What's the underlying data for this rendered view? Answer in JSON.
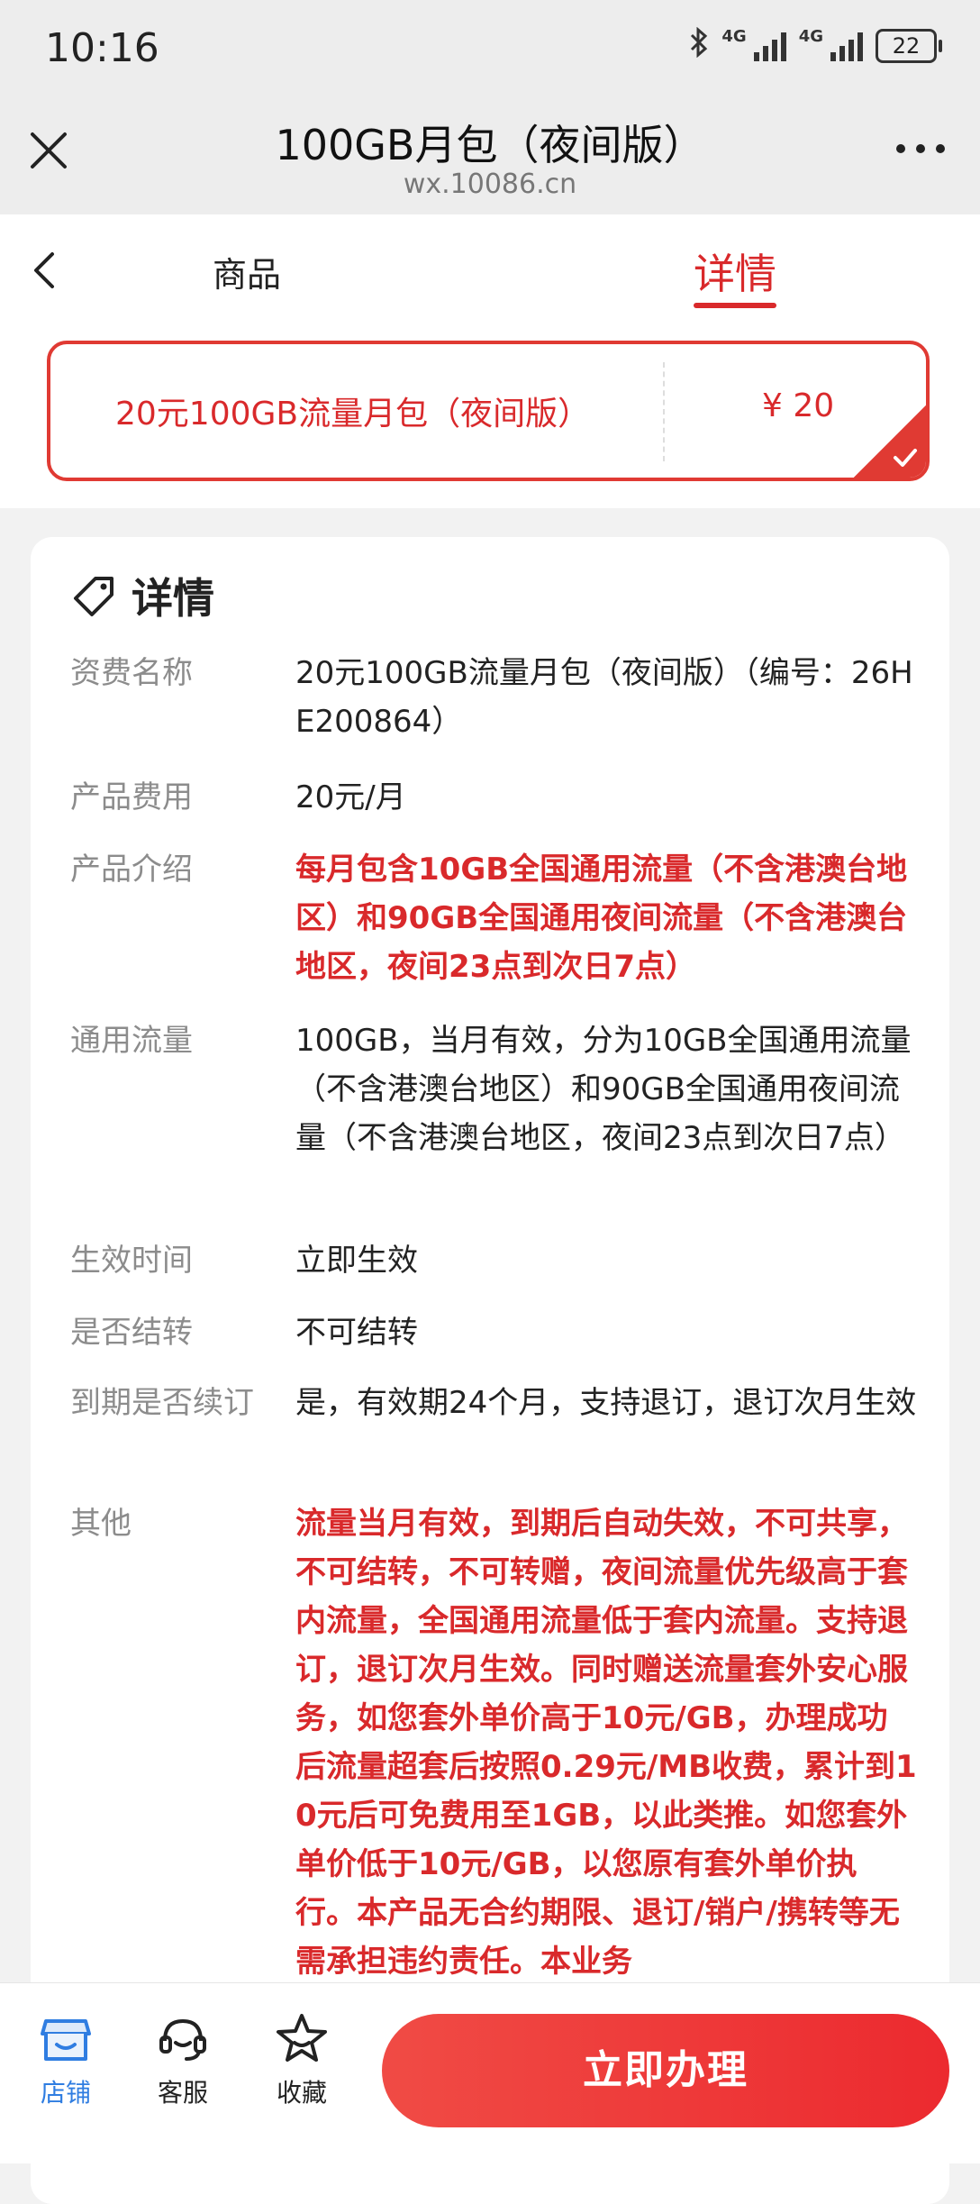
{
  "status_bar": {
    "time": "10:16",
    "signal1_label": "4G",
    "signal2_label": "4G",
    "battery": "22"
  },
  "title_bar": {
    "title": "100GB月包（夜间版）",
    "url": "wx.10086.cn"
  },
  "tabs": {
    "goods": "商品",
    "detail": "详情",
    "active": "详情"
  },
  "product": {
    "name": "20元100GB流量月包（夜间版）",
    "price": "¥ 20",
    "selected": true
  },
  "detail": {
    "title": "详情",
    "rows": [
      {
        "label": "资费名称",
        "value": "20元100GB流量月包（夜间版）（编号：26HE200864）",
        "emphasis": false
      },
      {
        "label": "产品费用",
        "value": "20元/月",
        "emphasis": false
      },
      {
        "label": "产品介绍",
        "value": "每月包含10GB全国通用流量（不含港澳台地区）和90GB全国通用夜间流量（不含港澳台地区，夜间23点到次日7点）",
        "emphasis": true
      },
      {
        "label": "通用流量",
        "value": "100GB，当月有效，分为10GB全国通用流量（不含港澳台地区）和90GB全国通用夜间流量（不含港澳台地区，夜间23点到次日7点）",
        "emphasis": false
      },
      {
        "label": "生效时间",
        "value": "立即生效",
        "emphasis": false
      },
      {
        "label": "是否结转",
        "value": "不可结转",
        "emphasis": false
      },
      {
        "label": "到期是否续订",
        "value": "是，有效期24个月，支持退订，退订次月生效",
        "emphasis": false
      },
      {
        "label": "其他",
        "value": "流量当月有效，到期后自动失效，不可共享，不可结转，不可转赠，夜间流量优先级高于套内流量，全国通用流量低于套内流量。支持退订，退订次月生效。同时赠送流量套外安心服务，如您套外单价高于10元/GB，办理成功后流量超套后按照0.29元/MB收费，累计到10元后可免费用至1GB，以此类推。如您套外单价低于10元/GB，以您原有套外单价执行。本产品无合约期限、退订/销户/携转等无需承担违约责任。本业务",
        "emphasis": true
      }
    ]
  },
  "bottom_bar": {
    "store": "店铺",
    "service": "客服",
    "favorite": "收藏",
    "apply": "立即办理"
  },
  "colors": {
    "accent": "#d9292b",
    "store_blue": "#2f7de1"
  }
}
